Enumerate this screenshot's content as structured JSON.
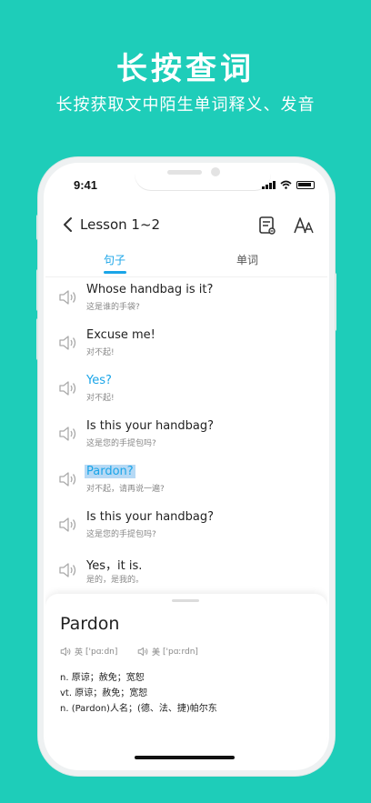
{
  "promo": {
    "headline": "长按查词",
    "subline": "长按获取文中陌生单词释义、发音"
  },
  "status_bar": {
    "time": "9:41"
  },
  "nav": {
    "back_icon": "chevron-left-icon",
    "title": "Lesson 1~2",
    "note_icon": "note-icon",
    "font_icon": "font-size-icon"
  },
  "tabs": [
    {
      "label": "句子",
      "active": true
    },
    {
      "label": "单词",
      "active": false
    }
  ],
  "sentences": [
    {
      "en": "Whose handbag is it?",
      "cn": "这是谁的手袋?"
    },
    {
      "en": "Excuse me!",
      "cn": "对不起!"
    },
    {
      "en": "Yes?",
      "cn": "对不起!"
    },
    {
      "en": "Is this your handbag?",
      "cn": "这是您的手提包吗?"
    },
    {
      "en": "Pardon?",
      "cn": "对不起，请再说一遍?"
    },
    {
      "en": "Is this your handbag?",
      "cn": "这是您的手提包吗?"
    },
    {
      "en": "Yes，it is.",
      "cn": "是的，是我的。"
    }
  ],
  "popup": {
    "word": "Pardon",
    "uk_label": "英",
    "uk_phonetic": "['pɑːdn]",
    "us_label": "美",
    "us_phonetic": "['pɑːrdn]",
    "definitions": [
      "n. 原谅；赦免；宽恕",
      "vt. 原谅；赦免；宽恕",
      "n. (Pardon)人名；(德、法、捷)帕尔东"
    ]
  },
  "colors": {
    "background": "#1ecdb9",
    "accent": "#1aa5e8",
    "highlight": "#b6d9f5"
  }
}
